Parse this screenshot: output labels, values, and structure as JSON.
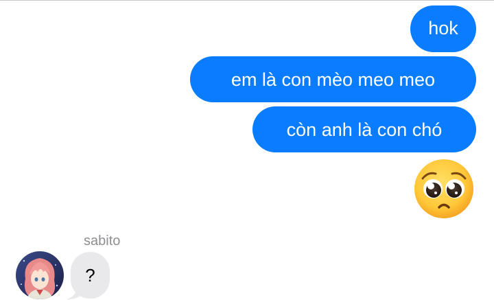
{
  "messages_outgoing": [
    {
      "text": "hok"
    },
    {
      "text": "em là con mèo meo meo"
    },
    {
      "text": "còn anh là con chó"
    }
  ],
  "reaction": {
    "icon": "pleading-face-emoji-icon"
  },
  "incoming": {
    "sender": "sabito",
    "text": "?",
    "avatar_icon": "anime-avatar-icon"
  },
  "colors": {
    "outgoing_bubble": "#0a7cff",
    "incoming_bubble": "#e9e9eb",
    "sender_name": "#8e8e93"
  }
}
